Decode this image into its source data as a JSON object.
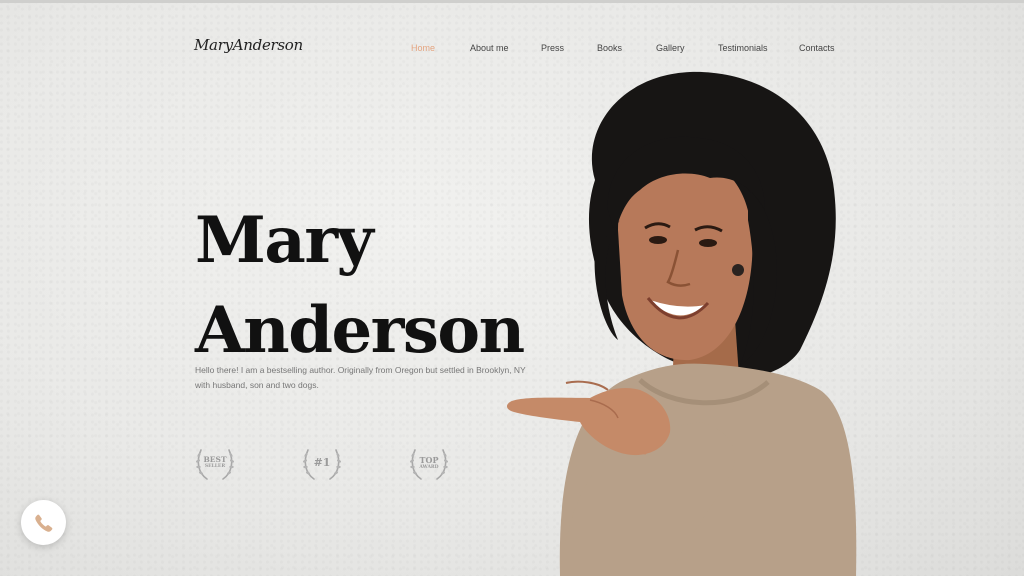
{
  "header": {
    "logo": "MaryAnderson",
    "nav": [
      {
        "label": "Home",
        "active": true
      },
      {
        "label": "About me",
        "active": false
      },
      {
        "label": "Press",
        "active": false
      },
      {
        "label": "Books",
        "active": false
      },
      {
        "label": "Gallery",
        "active": false
      },
      {
        "label": "Testimonials",
        "active": false
      },
      {
        "label": "Contacts",
        "active": false
      }
    ]
  },
  "hero": {
    "title_line1": "Mary",
    "title_line2": "Anderson",
    "intro": "Hello there! I am a bestselling author. Originally from Oregon but settled in Brooklyn, NY with husband, son and two dogs."
  },
  "awards": [
    {
      "icon": "laurel-wreath-icon",
      "line1": "BEST",
      "line2": "SELLER"
    },
    {
      "icon": "laurel-wreath-icon",
      "line1": "#1",
      "line2": ""
    },
    {
      "icon": "laurel-wreath-icon",
      "line1": "TOP",
      "line2": "AWARD"
    }
  ],
  "floating": {
    "icon": "phone-icon"
  },
  "colors": {
    "accent": "#e4a581",
    "text": "#111111",
    "muted": "#777777",
    "background": "#eaeae8"
  }
}
